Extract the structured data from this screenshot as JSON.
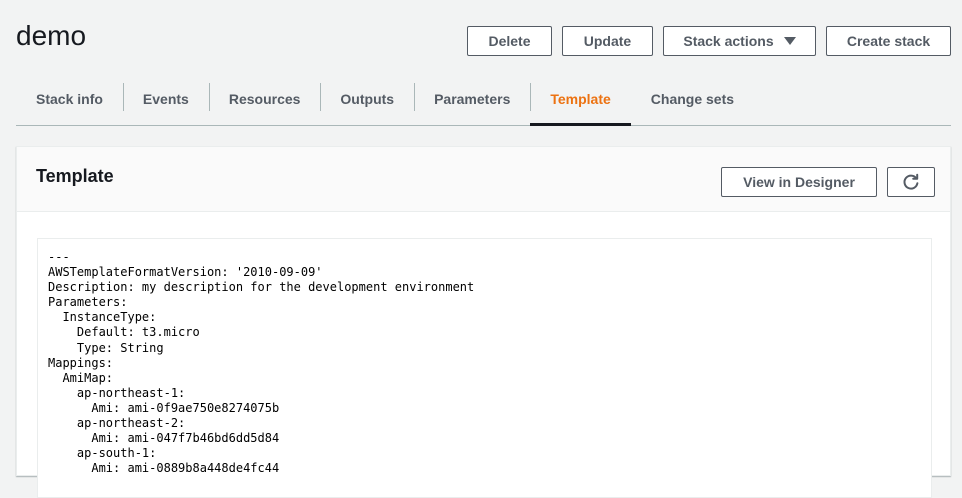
{
  "page": {
    "title": "demo"
  },
  "header_actions": {
    "delete_label": "Delete",
    "update_label": "Update",
    "stack_actions_label": "Stack actions",
    "create_stack_label": "Create stack"
  },
  "tabs": [
    {
      "label": "Stack info",
      "active": false
    },
    {
      "label": "Events",
      "active": false
    },
    {
      "label": "Resources",
      "active": false
    },
    {
      "label": "Outputs",
      "active": false
    },
    {
      "label": "Parameters",
      "active": false
    },
    {
      "label": "Template",
      "active": true
    },
    {
      "label": "Change sets",
      "active": false
    }
  ],
  "template_panel": {
    "title": "Template",
    "view_in_designer_label": "View in Designer",
    "refresh_icon": "refresh-icon",
    "code_lines": [
      "---",
      "AWSTemplateFormatVersion: '2010-09-09'",
      "Description: my description for the development environment",
      "Parameters:",
      "  InstanceType:",
      "    Default: t3.micro",
      "    Type: String",
      "Mappings:",
      "  AmiMap:",
      "    ap-northeast-1:",
      "      Ami: ami-0f9ae750e8274075b",
      "    ap-northeast-2:",
      "      Ami: ami-047f7b46bd6dd5d84",
      "    ap-south-1:",
      "      Ami: ami-0889b8a448de4fc44"
    ]
  },
  "colors": {
    "accent_active_tab": "#ec7211",
    "text_primary": "#16191f",
    "text_secondary": "#545b64",
    "background": "#f2f3f3",
    "divider": "#aab7b8"
  }
}
